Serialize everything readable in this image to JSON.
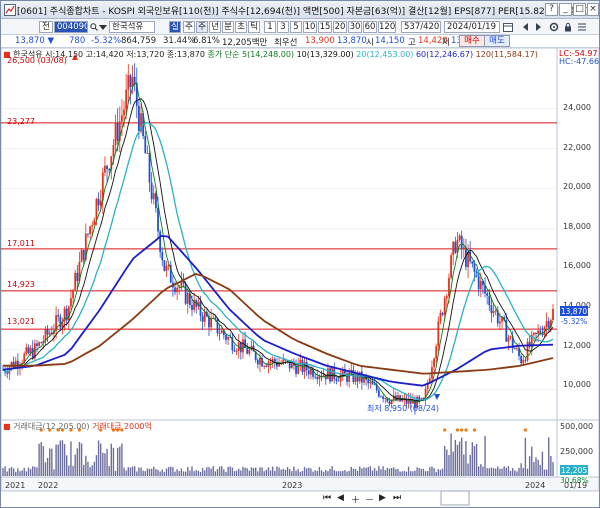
{
  "window": {
    "title": "[0601] 주식종합차트 - KOSPI 외국인보유[110(천)] 주식수[12,694(천)] 액면[500] 자본금[63(억)] 결산[12월] EPS[877] PER[15.82] 시가총액[",
    "buttons": [
      "?",
      "_",
      "□",
      "×"
    ]
  },
  "toolbar": {
    "type_select": "전",
    "code": "004090",
    "name": "한국석유",
    "quick_btn": "실",
    "periods": [
      "주",
      "월",
      "년",
      "분",
      "초",
      "틱"
    ],
    "period_active": "주",
    "intervals": [
      "1",
      "3",
      "5",
      "10",
      "15",
      "20",
      "30",
      "60",
      "120"
    ],
    "count": "537",
    "total": "4200",
    "date": "2024/01/19",
    "buy": "매수",
    "sell": "매도"
  },
  "quote": {
    "price": "13,870 ▼",
    "change": "780",
    "pct": "-5.32%",
    "volume": "864,759",
    "rate1": "31.44%",
    "rate2": "6.81%",
    "amount": "12,205백만",
    "best": "최우선",
    "bid": "13,900",
    "ask": "13,870",
    "open_label": "시",
    "open": "14,150",
    "high_label": "고",
    "high": "14,420",
    "low_label": "저",
    "low": "13,720"
  },
  "legend": {
    "ohlc": "한국석유 시:14,150 고:14,420 저:13,720 종:13,870",
    "ma_label": "종가 단순",
    "ma5": "5(14,248.00)",
    "ma10": "10(13,329.00)",
    "ma20": "20(12,453.00)",
    "ma60": "60(12,246.67)",
    "ma120": "120(11,584.17)",
    "lc": "LC:-54.97",
    "hc": "HC:-47.66",
    "vol": "거래대금(12,205.00)",
    "vol_ma": "거래대금 2000억"
  },
  "annotations": {
    "high_mark": "26,500 (03/08)",
    "low_mark": "최저 8,950 (08/24)",
    "hlines": [
      "23,277",
      "17,011",
      "14,923",
      "13,021"
    ]
  },
  "price_axis": [
    "24,000",
    "22,000",
    "20,000",
    "18,000",
    "16,000",
    "14,000",
    "12,000",
    "10,000"
  ],
  "price_tag": {
    "value": "13,870",
    "pct": "-5.32%"
  },
  "volume_axis": [
    "500,000",
    "250,000"
  ],
  "volume_tag": {
    "value": "12,205",
    "pct": "30.68%"
  },
  "time_axis": [
    "2021",
    "2022",
    "2023",
    "2024"
  ],
  "bottom_right": "01/19",
  "colors": {
    "up": "#e8311a",
    "down": "#1f4fd8",
    "ma5": "#0c7a1b",
    "ma10": "#111111",
    "ma20": "#2ab0c7",
    "ma60": "#1b1fc9",
    "ma120": "#8a3a12",
    "hline": "#d11"
  },
  "chart_data": {
    "type": "line",
    "x": [
      "2021-07",
      "2021-10",
      "2022-01",
      "2022-02",
      "2022-03",
      "2022-05",
      "2022-07",
      "2022-09",
      "2022-11",
      "2023-01",
      "2023-04",
      "2023-07",
      "2023-08",
      "2023-09",
      "2023-10",
      "2023-11",
      "2023-12",
      "2024-01"
    ],
    "series": [
      {
        "name": "한국석유",
        "values": [
          11000,
          12000,
          14000,
          20000,
          25500,
          16000,
          14000,
          12500,
          11500,
          11200,
          10800,
          10600,
          9500,
          9300,
          17500,
          14500,
          11500,
          13870
        ]
      },
      {
        "name": "60",
        "values": [
          11000,
          11200,
          11800,
          14000,
          16500,
          17800,
          16000,
          14000,
          12500,
          11800,
          11200,
          10800,
          10400,
          10200,
          11000,
          12000,
          12200,
          12246.67
        ]
      },
      {
        "name": "120",
        "values": [
          11200,
          11200,
          11300,
          12200,
          13500,
          15000,
          15800,
          15000,
          13500,
          12500,
          11800,
          11200,
          11000,
          10800,
          10900,
          11000,
          11200,
          11584.17
        ]
      }
    ],
    "ylim": [
      8500,
      27000
    ]
  }
}
